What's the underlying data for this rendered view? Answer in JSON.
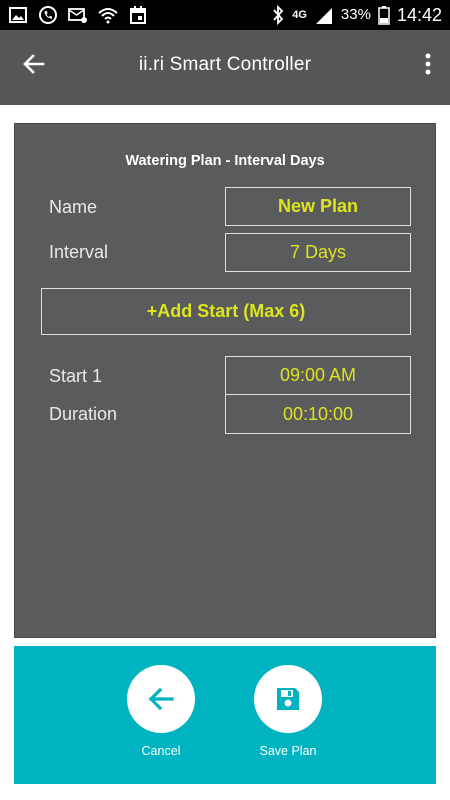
{
  "status_bar": {
    "battery": "33%",
    "network": "4G",
    "time": "14:42",
    "icons": [
      "gallery-icon",
      "phone-icon",
      "mail-icon",
      "wifi-question-icon",
      "calendar-icon",
      "bluetooth-icon",
      "signal-icon",
      "battery-icon"
    ]
  },
  "app_bar": {
    "title": "ii.ri Smart Controller",
    "back_icon": "arrow-left-icon",
    "menu_icon": "more-vert-icon"
  },
  "plan": {
    "title": "Watering Plan - Interval Days",
    "name_label": "Name",
    "name_value": "New Plan",
    "interval_label": "Interval",
    "interval_value": "7 Days",
    "add_start_label": "+Add Start (Max 6)",
    "start1_label": "Start 1",
    "start1_value": "09:00 AM",
    "duration_label": "Duration",
    "duration_value": "00:10:00"
  },
  "actions": {
    "cancel_label": "Cancel",
    "save_label": "Save Plan"
  },
  "colors": {
    "appbar": "#555657",
    "card": "#5a5b5c",
    "accent_text": "#dde51e",
    "bottom_panel": "#00b3c0",
    "button_icon": "#00b3c0"
  }
}
